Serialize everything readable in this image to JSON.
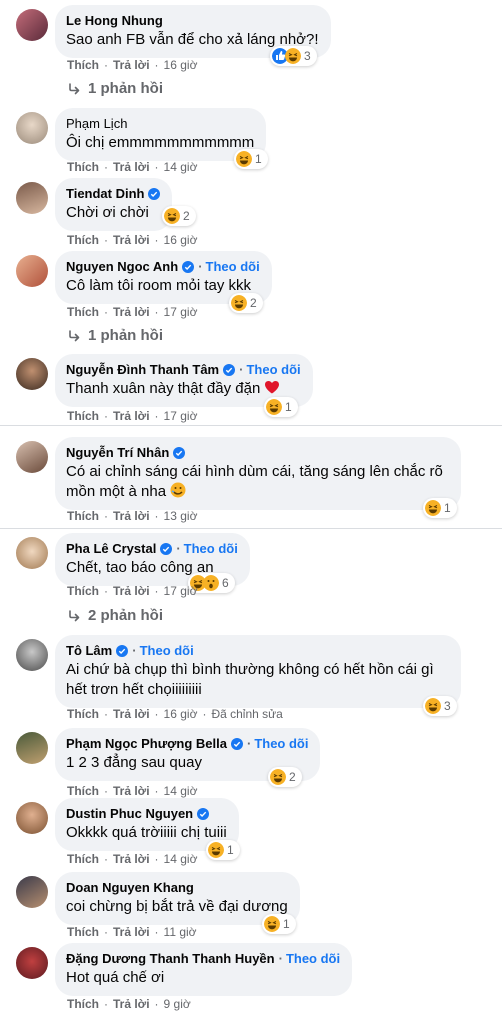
{
  "labels": {
    "like": "Thích",
    "reply": "Trả lời",
    "follow": "Theo dõi",
    "dot": "·"
  },
  "comments": [
    {
      "name": "Le Hong Nhung",
      "text": "Sao anh FB vẫn để cho xả láng nhở?!",
      "time": "16 giờ",
      "reaction_count": "3",
      "replies": "1 phản hồi"
    },
    {
      "name": "Phạm Lịch",
      "text": "Ôi chị emmmmmmmmmmm",
      "time": "14 giờ",
      "reaction_count": "1"
    },
    {
      "name": "Tiendat Dinh",
      "text": "Chời ơi chời",
      "time": "16 giờ",
      "reaction_count": "2"
    },
    {
      "name": "Nguyen Ngoc Anh",
      "text": "Cô làm tôi room mỏi tay kkk",
      "time": "17 giờ",
      "reaction_count": "2",
      "replies": "1 phản hồi"
    },
    {
      "name": "Nguyễn Đình Thanh Tâm",
      "text": "Thanh xuân này thật đầy đặn",
      "time": "17 giờ",
      "reaction_count": "1"
    },
    {
      "name": "Nguyễn Trí Nhân",
      "text": "Có ai chỉnh sáng cái hình dùm cái, tăng sáng lên chắc rõ mồn một à nha",
      "time": "13 giờ",
      "reaction_count": "1"
    },
    {
      "name": "Pha Lê Crystal",
      "text": "Chết, tao báo công an",
      "time": "17 giờ",
      "reaction_count": "6",
      "replies": "2 phản hồi"
    },
    {
      "name": "Tô Lâm",
      "text": "Ai chứ bà chụp thì bình thường không có hết hồn cái gì hết trơn hết chọiiiiiiiii",
      "time": "16 giờ",
      "edited": "Đã chỉnh sửa",
      "reaction_count": "3"
    },
    {
      "name": "Phạm Ngọc Phượng Bella",
      "text": "1 2 3 đẳng sau quay",
      "time": "14 giờ",
      "reaction_count": "2"
    },
    {
      "name": "Dustin Phuc Nguyen",
      "text": "Okkkk quá trờiiiii chị tuiii",
      "time": "14 giờ",
      "reaction_count": "1"
    },
    {
      "name": "Doan Nguyen Khang",
      "text": "coi chừng bị bắt trả về đại dương",
      "time": "11 giờ",
      "reaction_count": "1"
    },
    {
      "name": "Đặng Dương Thanh Thanh Huyền",
      "text": "Hot quá chế ơi",
      "time": "9 giờ"
    }
  ],
  "colors": {
    "bubble": "#f0f2f5",
    "link": "#1877f2",
    "meta": "#65676b",
    "haha": "#f7b125",
    "like": "#1877f2",
    "love": "#f33e58"
  }
}
